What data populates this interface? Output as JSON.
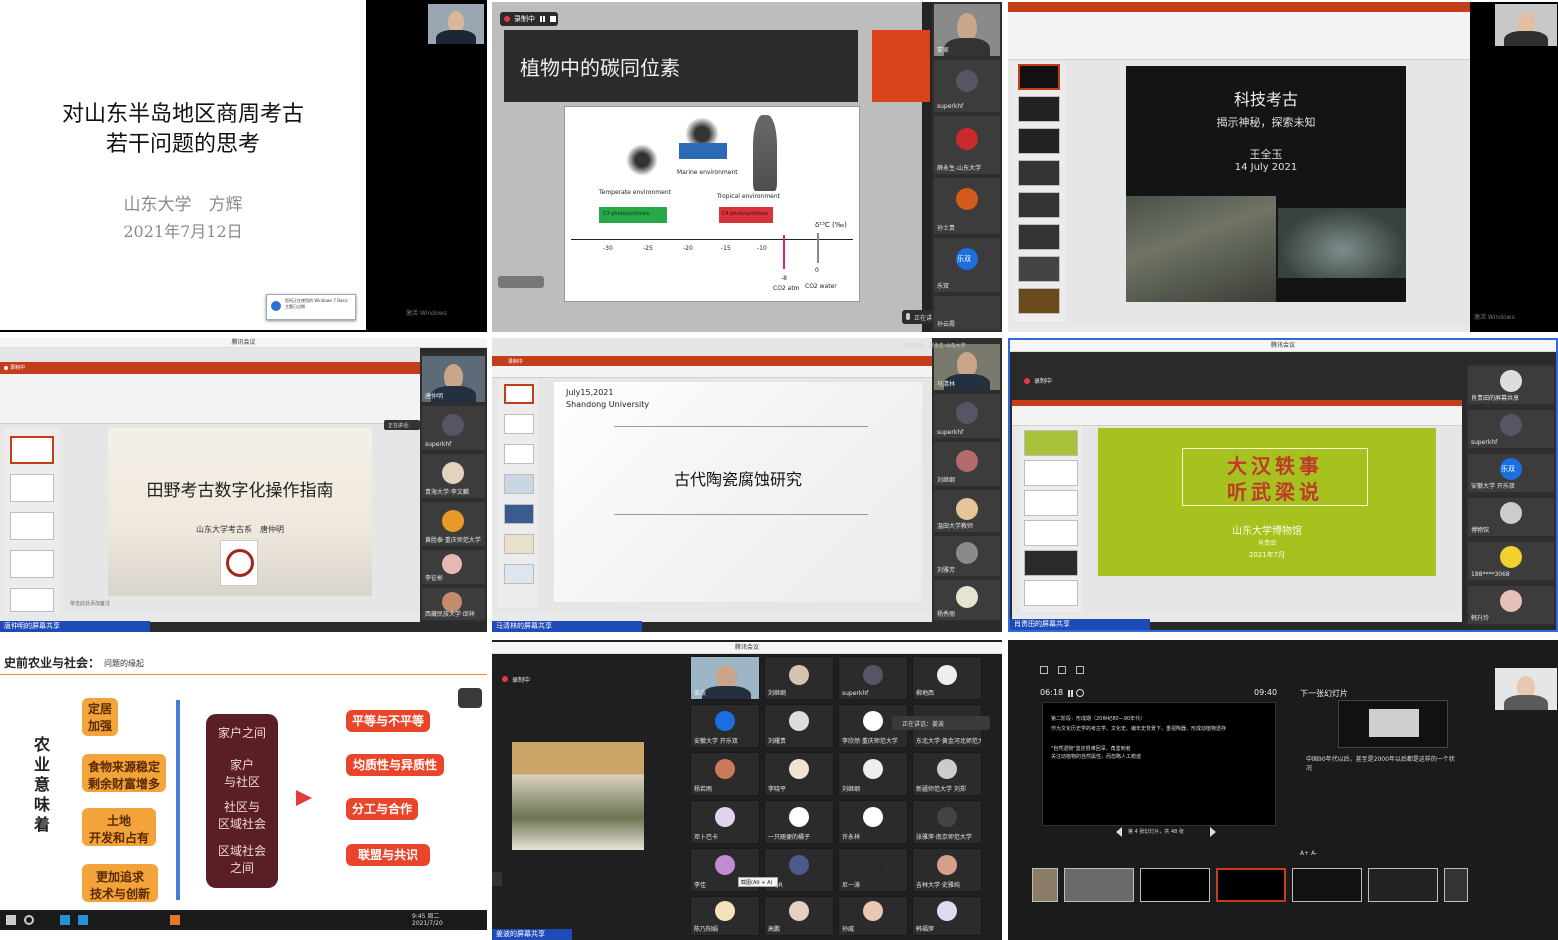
{
  "p1": {
    "title_line1": "对山东半岛地区商周考古",
    "title_line2": "若干问题的思考",
    "author": "山东大学　方辉",
    "date": "2021年7月12日",
    "popup_text": "您所正在使用的 Windows 7 Basic 主题已过期",
    "watermark": "激活 Windows"
  },
  "p2": {
    "rec_label": "录制中",
    "slide_title": "植物中的碳同位素",
    "temperate": "Temperate environment",
    "marine": "Marine environment",
    "tropical": "Tropical environment",
    "c3_label": "C3 photosynthesis",
    "c4_label": "C4 photosynthesis",
    "axis_label": "δ¹³C (‰)",
    "ticks": [
      "-30",
      "-25",
      "-20",
      "-15",
      "-10",
      "-8",
      "0"
    ],
    "co2_atm": "CO2 atm",
    "co2_water": "CO2 water",
    "speaking": "正在讲话：董家",
    "strip_names": [
      "蒙家",
      "superkhf",
      "薛永生-山东大学",
      "孙士贵",
      "乐双",
      "孙云霞"
    ],
    "avatar_label": "乐双"
  },
  "p3": {
    "slide_title": "科技考古",
    "subtitle": "揭示神秘，探索未知",
    "presenter": "王全玉",
    "date": "14 July 2021",
    "watermark": "激活 Windows"
  },
  "p4": {
    "window_title": "腾讯会议",
    "rec_label": "录制中",
    "slide_title": "田野考古数字化操作指南",
    "slide_sub": "山东大学考古系　唐仲明",
    "speaking": "正在讲话：",
    "share_label": "唐仲明的屏幕共享",
    "strip_names": [
      "唐仲明",
      "superkhf",
      "青海大学·李文麟",
      "黄胜泰·重庆师范大学",
      "李征彬",
      "西藏民族大学·邱祥"
    ],
    "notes": "单击此处添加备注"
  },
  "p5": {
    "rec_label": "录制中",
    "slide_date": "July15,2021",
    "slide_univ": "Shandong University",
    "slide_title": "古代陶瓷腐蚀研究",
    "share_label": "马清林的屏幕共享",
    "speaking": "正在讲话：赵永生·山东大学",
    "strip_names": [
      "马清林",
      "superkhf",
      "刘继纲",
      "温田大学教师",
      "刘雅芳",
      "杨秀丽"
    ]
  },
  "p6": {
    "window_title": "腾讯会议",
    "rec_label": "录制中",
    "slide_line1": "大汉轶事",
    "slide_line2": "听武梁说",
    "slide_org": "山东大学博物馆",
    "slide_person": "肖贵田",
    "slide_date": "2021年7月",
    "share_label": "肖贵田的屏幕共享",
    "strip_names": [
      "肖贵田的屏幕共享",
      "superkhf",
      "安徽大学 开乐双",
      "博物馆",
      "188****3068",
      "韩升玲"
    ],
    "avatar_label": "乐双"
  },
  "p7": {
    "title": "史前农业与社会：",
    "title_sub": "问题的缘起",
    "vertical_text": "农业意味着",
    "left_items": [
      "定居\n加强",
      "食物来源稳定\n剩余财富增多",
      "土地\n开发和占有",
      "更加追求\n技术与创新"
    ],
    "center_items": [
      "家户之间",
      "家户\n与社区",
      "社区与\n区域社会",
      "区域社会\n之间"
    ],
    "right_items": [
      "平等与不平等",
      "均质性与异质性",
      "分工与合作",
      "联盟与共识"
    ],
    "clock": "9:45 周二",
    "clock_date": "2021/7/20"
  },
  "p8": {
    "window_title": "腾讯会议",
    "rec_label": "录制中",
    "share_label": "姜波的屏幕共享",
    "speaking": "正在讲话：姜波",
    "tooltip": "截图(Alt + A)",
    "tiles": [
      "姜波",
      "刘继纲",
      "superkhf",
      "柳地西",
      "安徽大学 开乐双",
      "刘耀贵",
      "李欣然·重庆师范大学",
      "东北大学·黄金河北师范大学",
      "杨若雨",
      "李晓平",
      "刘继纲",
      "新疆师范大学 刘郑",
      "邓卜巴卡",
      "一只随便的橘子",
      "许永祥",
      "张雅萍·南京师范大学",
      "李佳",
      "WQR",
      "尼一涛",
      "吉林大学·史雅纯",
      "陈乃阳娟",
      "高鹏",
      "孙威",
      "韩福萍"
    ]
  },
  "p9": {
    "time_elapsed": "06:18",
    "time_total": "09:40",
    "next_label": "下一张幻灯片",
    "slide_text_1": "第二阶段：形成期（20世纪80—90年代）",
    "slide_text_2": "作为文化历史学的考古学、文化史、编年史背景下，重视陶器、形成动植物遗存",
    "slide_text_3": "\"自然遗物\"鉴定很难回深、角鉴到者",
    "slide_text_4": "关注动植物的自然属性，而忽略人工痕迹",
    "note_text": "中国90年代以后，甚至是2000年以后都是这样的一个状况",
    "counter": "第 4 张幻灯片，共 48 张",
    "font_controls": "A+  A-"
  }
}
